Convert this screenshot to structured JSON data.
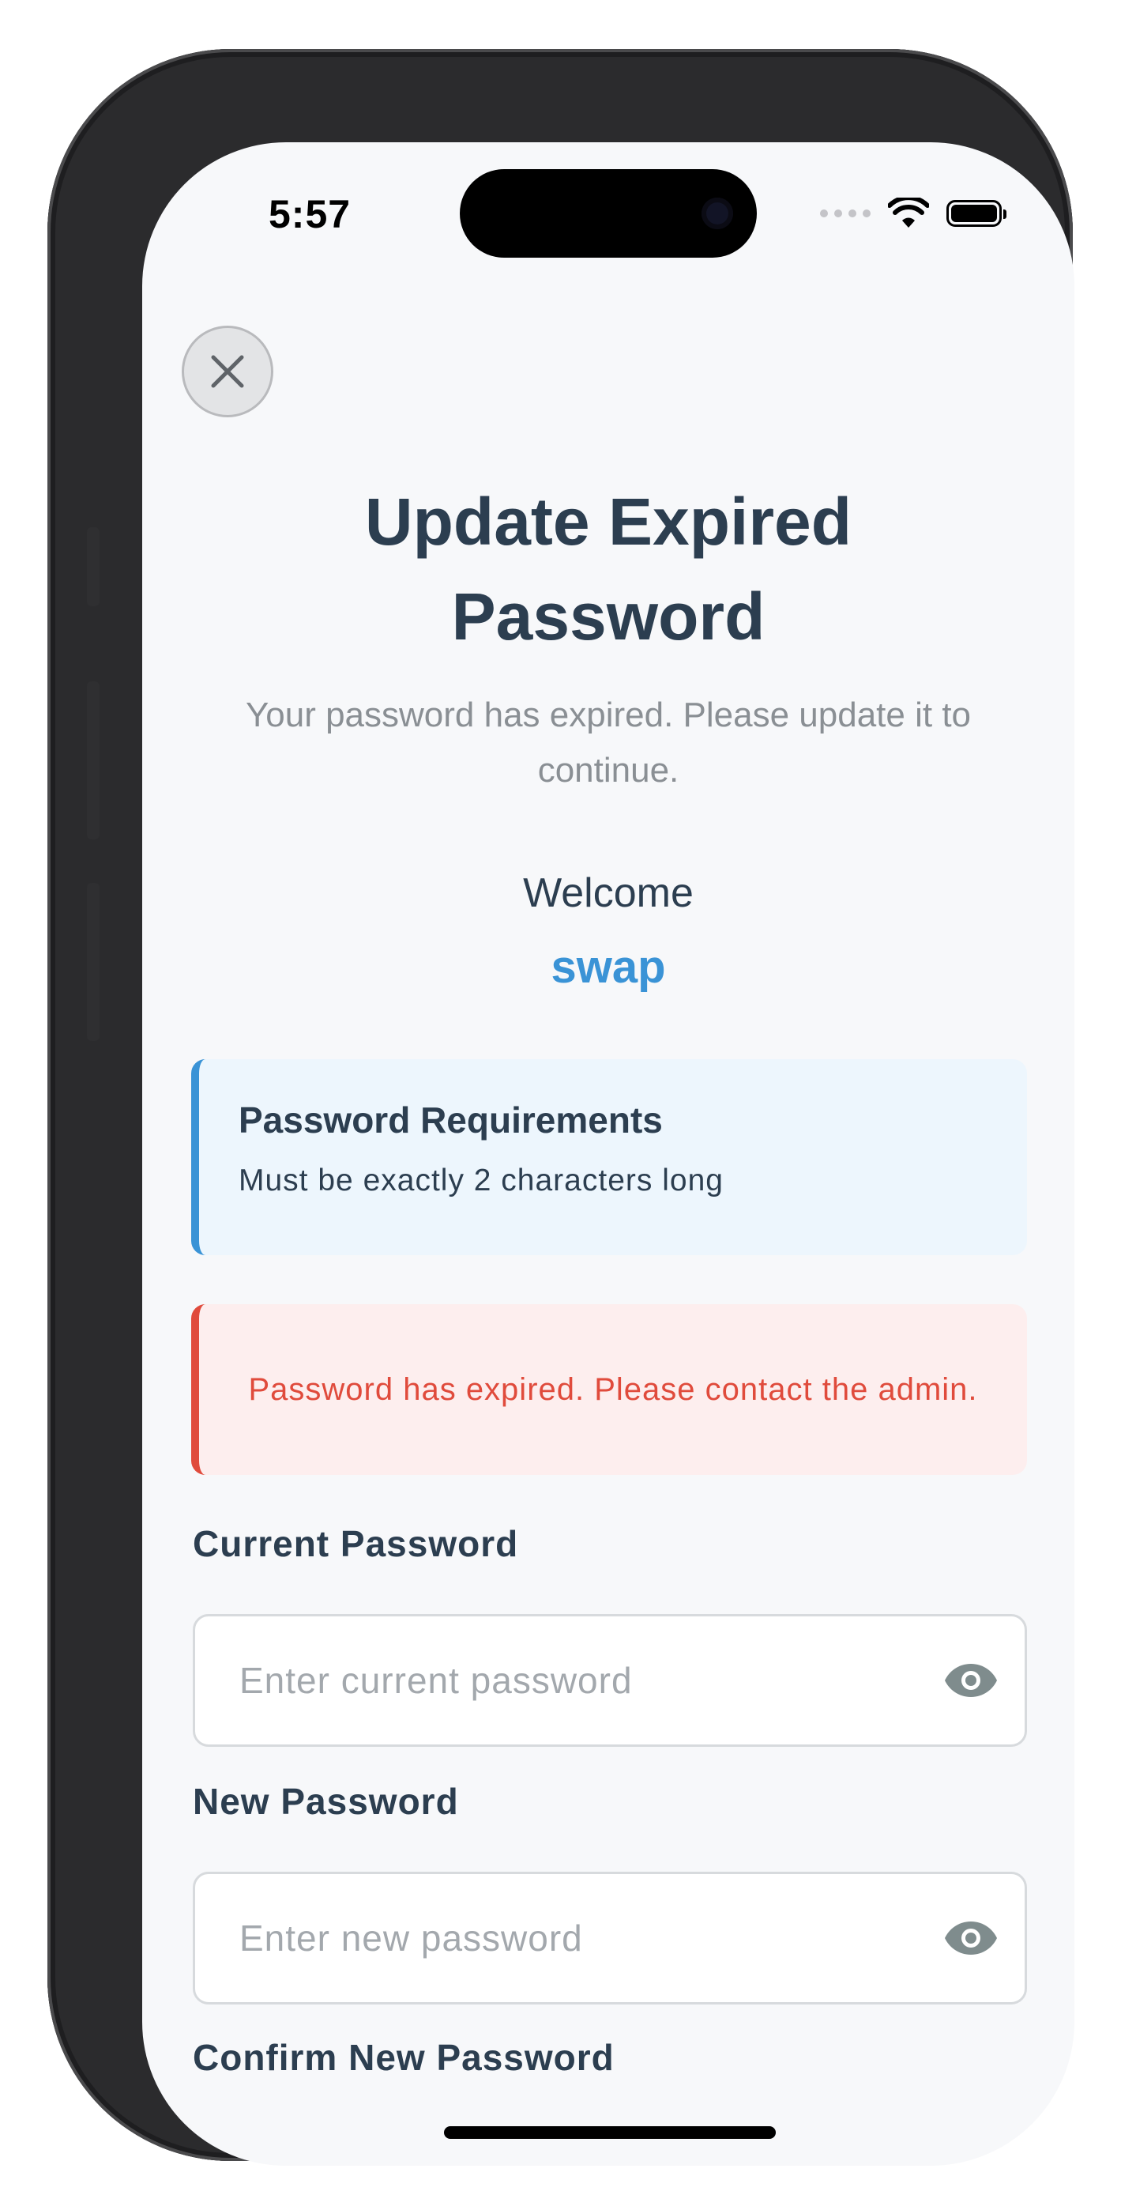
{
  "status_bar": {
    "time": "5:57"
  },
  "header": {
    "close_icon": "close-icon",
    "title_line1": "Update Expired",
    "title_line2": "Password",
    "subtitle": "Your password has expired. Please update it to continue."
  },
  "welcome": {
    "label": "Welcome",
    "username": "swap"
  },
  "requirements": {
    "title": "Password Requirements",
    "text": "Must be exactly 2 characters long"
  },
  "error": {
    "message": "Password has expired. Please contact the admin."
  },
  "form": {
    "current": {
      "label": "Current Password",
      "placeholder": "Enter current password",
      "value": ""
    },
    "new": {
      "label": "New Password",
      "placeholder": "Enter new password",
      "value": ""
    },
    "confirm": {
      "label": "Confirm New Password"
    }
  },
  "colors": {
    "accent": "#3a93d6",
    "title": "#2c3e50",
    "error": "#e04b3c",
    "info_bg": "#edf6fd",
    "error_bg": "#fdeeee",
    "screen_bg": "#f7f8fa"
  },
  "icons": {
    "visibility": "eye-icon",
    "wifi": "wifi-icon",
    "battery": "battery-icon"
  }
}
